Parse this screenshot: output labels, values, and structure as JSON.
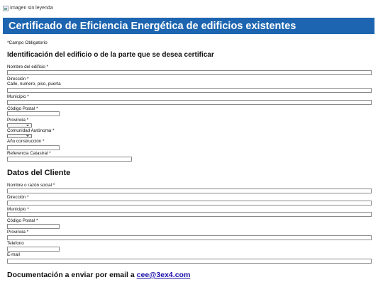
{
  "image_placeholder": {
    "alt": "Imagen sin leyenda"
  },
  "header": {
    "title": "Certificado de Eficiencia Energética de edificios existentes"
  },
  "required_note": "*Campo Obligatorio",
  "building_section": {
    "title": "Identificación del edificio o de la parte que se desea certificar",
    "fields": {
      "nombre_label": "Nombre del edificio *",
      "direccion_label": "Dirección *",
      "direccion_hint": "Calle, numero, piso, puerta",
      "municipio_label": "Municipio *",
      "cp_label": "Código Postal *",
      "provincia_label": "Provincia *",
      "comunidad_label": "Comunidad Autónoma *",
      "anio_label": "Año construcción *",
      "catastral_label": "Referencia Catastral *"
    }
  },
  "client_section": {
    "title": "Datos del Cliente",
    "fields": {
      "nombre_label": "Nombre o razón social *",
      "direccion_label": "Dirección *",
      "municipio_label": "Municipio *",
      "cp_label": "Código Postal *",
      "provincia_label": "Provincia *",
      "telefono_label": "Telefono",
      "email_label": "E-mail"
    }
  },
  "documentation": {
    "text": "Documentación a enviar por email a",
    "email": "cee@3ex4.com"
  },
  "colors": {
    "banner": "#1d65b0",
    "link": "#1a0dab"
  }
}
